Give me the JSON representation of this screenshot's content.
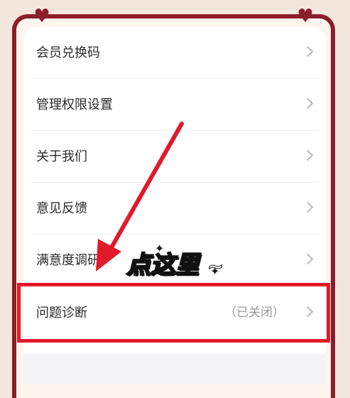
{
  "menu": {
    "items": [
      {
        "label": "会员兑换码",
        "status": ""
      },
      {
        "label": "管理权限设置",
        "status": ""
      },
      {
        "label": "关于我们",
        "status": ""
      },
      {
        "label": "意见反馈",
        "status": ""
      },
      {
        "label": "满意度调研",
        "status": ""
      },
      {
        "label": "问题诊断",
        "status": "（已关闭）"
      }
    ]
  },
  "annotation": {
    "callout_part1": "点",
    "callout_part2": "这",
    "callout_part3": "里",
    "callout_tail": "~",
    "highlight_color": "#e2192b",
    "arrow_color": "#e2192b"
  },
  "theme": {
    "frame_color": "#8b1d2c",
    "background": "#f3e6da"
  }
}
